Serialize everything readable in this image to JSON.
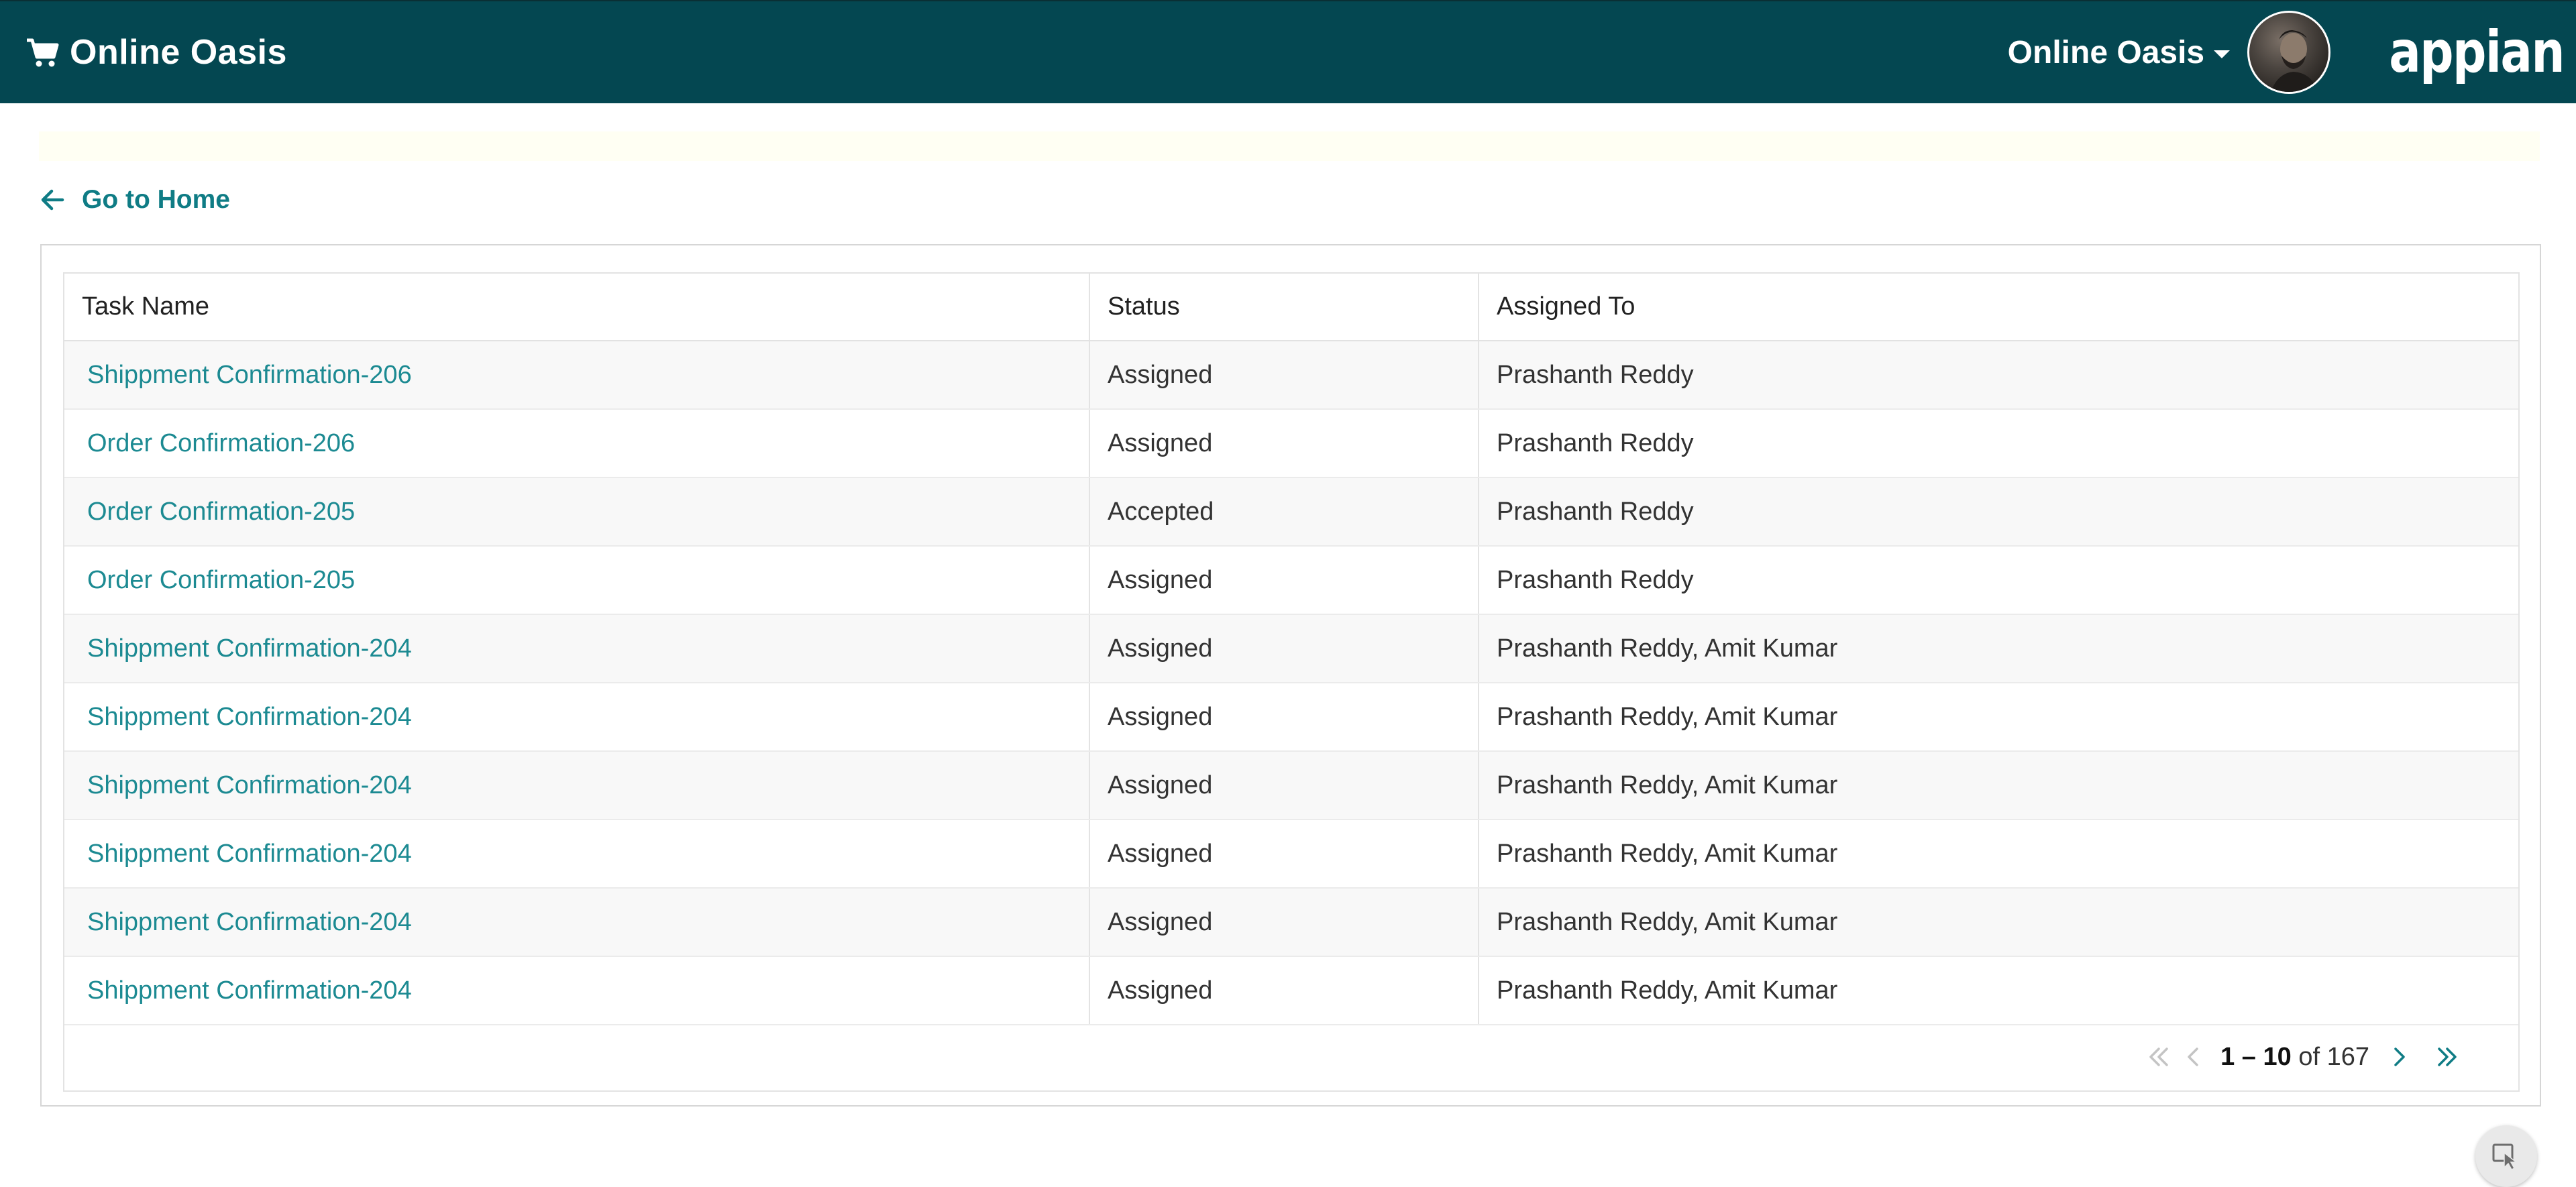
{
  "header": {
    "app_title": "Online Oasis",
    "site_menu_label": "Online Oasis",
    "logo_text": "appian",
    "colors": {
      "bar": "#044751",
      "text": "#ffffff"
    }
  },
  "nav": {
    "home_link_label": "Go to Home"
  },
  "grid": {
    "columns": [
      "Task Name",
      "Status",
      "Assigned To"
    ],
    "rows": [
      {
        "task": "Shippment Confirmation-206",
        "status": "Assigned",
        "assigned_to": "Prashanth Reddy"
      },
      {
        "task": "Order Confirmation-206",
        "status": "Assigned",
        "assigned_to": "Prashanth Reddy"
      },
      {
        "task": "Order Confirmation-205",
        "status": "Accepted",
        "assigned_to": "Prashanth Reddy"
      },
      {
        "task": "Order Confirmation-205",
        "status": "Assigned",
        "assigned_to": "Prashanth Reddy"
      },
      {
        "task": "Shippment Confirmation-204",
        "status": "Assigned",
        "assigned_to": "Prashanth Reddy, Amit Kumar"
      },
      {
        "task": "Shippment Confirmation-204",
        "status": "Assigned",
        "assigned_to": "Prashanth Reddy, Amit Kumar"
      },
      {
        "task": "Shippment Confirmation-204",
        "status": "Assigned",
        "assigned_to": "Prashanth Reddy, Amit Kumar"
      },
      {
        "task": "Shippment Confirmation-204",
        "status": "Assigned",
        "assigned_to": "Prashanth Reddy, Amit Kumar"
      },
      {
        "task": "Shippment Confirmation-204",
        "status": "Assigned",
        "assigned_to": "Prashanth Reddy, Amit Kumar"
      },
      {
        "task": "Shippment Confirmation-204",
        "status": "Assigned",
        "assigned_to": "Prashanth Reddy, Amit Kumar"
      }
    ],
    "link_color": "#1c8a92"
  },
  "pager": {
    "range_start": "1",
    "range_sep": " – ",
    "range_end": "10",
    "of_label": " of ",
    "total": "167",
    "icons": [
      "first-page-icon",
      "prev-page-icon",
      "next-page-icon",
      "last-page-icon"
    ]
  },
  "icons": {
    "cart": "cart-icon",
    "back": "arrow-left-icon",
    "caret": "caret-down-icon",
    "select": "select-pointer-icon"
  }
}
